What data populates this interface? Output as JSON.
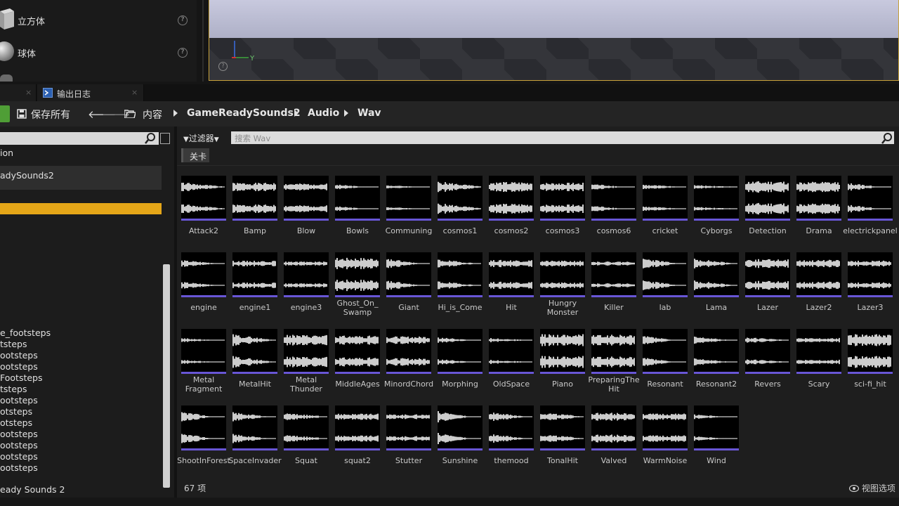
{
  "place_actors": {
    "items": [
      {
        "label": "立方体",
        "icon": "cube-icon"
      },
      {
        "label": "球体",
        "icon": "sphere-icon"
      }
    ],
    "help_glyph": "?"
  },
  "viewport": {
    "axis_label": "Y",
    "help_glyph": "?"
  },
  "tabs": [
    {
      "label": "输出日志",
      "icon": "output-log-icon",
      "close": "×"
    }
  ],
  "toolbar": {
    "save_all_label": "保存所有",
    "breadcrumbs": [
      "内容",
      "GameReadySounds2",
      "Audio",
      "Wav"
    ]
  },
  "sources": {
    "items": [
      "ion",
      "adySounds2"
    ],
    "footsteps": [
      "e_footsteps",
      "tsteps",
      "ootsteps",
      "ootsteps",
      "Footsteps",
      "tsteps",
      "ootsteps",
      "otsteps",
      "otsteps",
      "ootsteps",
      "ootsteps",
      "ootsteps",
      "ootsteps"
    ],
    "bottom_label": "eady Sounds 2"
  },
  "filter": {
    "label": "过滤器",
    "search_placeholder": "搜索 Wav",
    "chip": "关卡"
  },
  "assets": [
    {
      "name": "Attack2"
    },
    {
      "name": "Bamp"
    },
    {
      "name": "Blow"
    },
    {
      "name": "Bowls"
    },
    {
      "name": "Communing"
    },
    {
      "name": "cosmos1"
    },
    {
      "name": "cosmos2"
    },
    {
      "name": "cosmos3"
    },
    {
      "name": "cosmos6"
    },
    {
      "name": "cricket"
    },
    {
      "name": "Cyborgs"
    },
    {
      "name": "Detection"
    },
    {
      "name": "Drama"
    },
    {
      "name": "electrickpanel"
    },
    {
      "name": "engine"
    },
    {
      "name": "engine1"
    },
    {
      "name": "engine3"
    },
    {
      "name": "Ghost_On_ Swamp"
    },
    {
      "name": "Giant"
    },
    {
      "name": "Hi_is_Come"
    },
    {
      "name": "Hit"
    },
    {
      "name": "Hungry Monster"
    },
    {
      "name": "Killer"
    },
    {
      "name": "lab"
    },
    {
      "name": "Lama"
    },
    {
      "name": "Lazer"
    },
    {
      "name": "Lazer2"
    },
    {
      "name": "Lazer3"
    },
    {
      "name": "Metal Fragment"
    },
    {
      "name": "MetalHit"
    },
    {
      "name": "Metal Thunder"
    },
    {
      "name": "MiddleAges"
    },
    {
      "name": "MinordChord"
    },
    {
      "name": "Morphing"
    },
    {
      "name": "OldSpace"
    },
    {
      "name": "Piano"
    },
    {
      "name": "PreparingThe Hit"
    },
    {
      "name": "Resonant"
    },
    {
      "name": "Resonant2"
    },
    {
      "name": "Revers"
    },
    {
      "name": "Scary"
    },
    {
      "name": "sci-fi_hit"
    },
    {
      "name": "ShootInForest"
    },
    {
      "name": "SpaceInvader"
    },
    {
      "name": "Squat"
    },
    {
      "name": "squat2"
    },
    {
      "name": "Stutter"
    },
    {
      "name": "Sunshine"
    },
    {
      "name": "themood"
    },
    {
      "name": "TonalHit"
    },
    {
      "name": "Valved"
    },
    {
      "name": "WarmNoise"
    },
    {
      "name": "Wind"
    }
  ],
  "status": {
    "item_count": "67 项",
    "view_options": "视图选项"
  },
  "colors": {
    "accent_orange": "#e5a618",
    "audio_bar": "#6856d6",
    "add_green": "#4f9e36"
  }
}
